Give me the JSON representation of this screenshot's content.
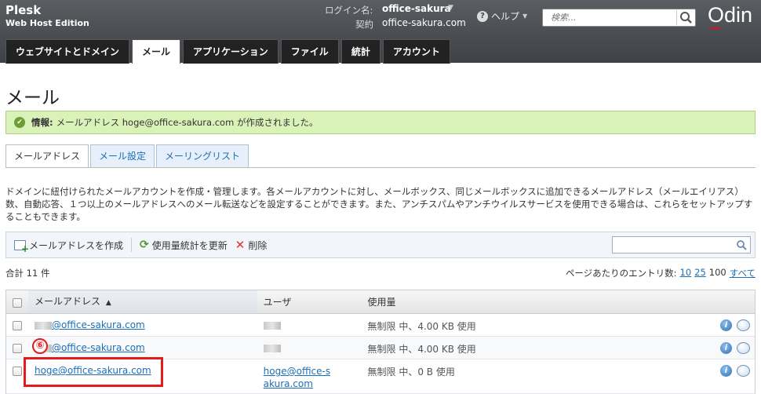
{
  "header": {
    "brand_line1": "Plesk",
    "brand_line2": "Web Host Edition",
    "login_label": "ログイン名:",
    "login_value": "office-sakura",
    "contract_label": "契約",
    "contract_value": "office-sakura.com",
    "help_label": "ヘルプ",
    "search_placeholder": "検索...",
    "logo": "Odin"
  },
  "nav_tabs": [
    {
      "label": "ウェブサイトとドメイン",
      "active": false
    },
    {
      "label": "メール",
      "active": true
    },
    {
      "label": "アプリケーション",
      "active": false
    },
    {
      "label": "ファイル",
      "active": false
    },
    {
      "label": "統計",
      "active": false
    },
    {
      "label": "アカウント",
      "active": false
    }
  ],
  "page_title": "メール",
  "message": {
    "label": "情報:",
    "text": "メールアドレス hoge@office-sakura.com が作成されました。"
  },
  "sub_tabs": [
    {
      "label": "メールアドレス",
      "active": true
    },
    {
      "label": "メール設定",
      "active": false
    },
    {
      "label": "メーリングリスト",
      "active": false
    }
  ],
  "description": "ドメインに紐付けられたメールアカウントを作成・管理します。各メールアカウントに対し、メールボックス、同じメールボックスに追加できるメールアドレス（メールエイリアス）数、自動応答、１つ以上のメールアドレスへのメール転送などを設定することができます。また、アンチスパムやアンチウイルスサービスを使用できる場合は、これらをセットアップすることもできます。",
  "toolbar": {
    "create_label": "メールアドレスを作成",
    "refresh_label": "使用量統計を更新",
    "delete_label": "削除"
  },
  "list_info": {
    "total": "合計 11 件",
    "per_page_label": "ページあたりのエントリ数:",
    "opt_10": "10",
    "opt_25": "25",
    "opt_100": "100",
    "opt_all": "すべて"
  },
  "table": {
    "headers": {
      "email": "メールアドレス",
      "sort_arrow": "▲",
      "user": "ユーザ",
      "usage": "使用量"
    },
    "rows": [
      {
        "email": "@office-sakura.com",
        "user": "",
        "usage": "無制限 中、4.00 KB 使用"
      },
      {
        "email": "@office-sakura.com",
        "user": "",
        "usage": "無制限 中、4.00 KB 使用"
      },
      {
        "email": "hoge@office-sakura.com",
        "user": "hoge@office-sakura.com",
        "usage": "無制限 中、0 B 使用"
      }
    ]
  },
  "annotation": {
    "step_number": "⑥"
  },
  "colors": {
    "header_bg": "#4a4d51",
    "link": "#1b6fb6",
    "success_bg": "#d8f2b8",
    "highlight_red": "#e21b1b"
  }
}
